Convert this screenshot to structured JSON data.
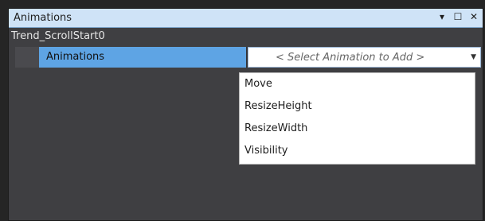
{
  "panel": {
    "title": "Animations",
    "icons": [
      "dropdown-arrow-icon",
      "maximize-icon",
      "close-icon"
    ]
  },
  "object_name": "Trend_ScrollStart0",
  "property_row": {
    "label": "Animations",
    "select_placeholder": "< Select Animation to Add >"
  },
  "dropdown": {
    "options": [
      "Move",
      "ResizeHeight",
      "ResizeWidth",
      "Visibility"
    ]
  },
  "colors": {
    "title_bg": "#cfe3f7",
    "selected_row_bg": "#5ea4e4",
    "panel_bg": "#3f3f42"
  }
}
